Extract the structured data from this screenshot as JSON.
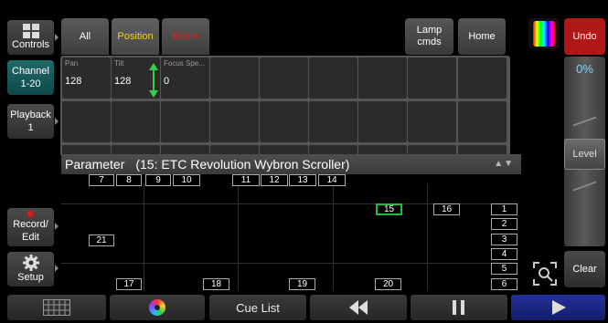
{
  "sidebar": {
    "controls": "Controls",
    "channel": [
      "Channel",
      "1-20"
    ],
    "playback": [
      "Playback",
      "1"
    ],
    "record": [
      "Record/",
      "Edit"
    ],
    "setup": "Setup"
  },
  "tabs": {
    "all": "All",
    "position": "Position",
    "beam": "Beam"
  },
  "toolbar": {
    "lamp": [
      "Lamp",
      "cmds"
    ],
    "home": "Home"
  },
  "params": [
    {
      "label": "Pan",
      "value": "128"
    },
    {
      "label": "Tilt",
      "value": "128"
    },
    {
      "label": "Focus Spe...",
      "value": "0"
    }
  ],
  "parameter_bar": {
    "title": "Parameter",
    "fixture": "(15: ETC Revolution Wybron Scroller)"
  },
  "channels": {
    "row1": [
      "7",
      "8",
      "9",
      "10",
      "11",
      "12",
      "13",
      "14"
    ],
    "ch15": "15",
    "ch16": "16",
    "ch21": "21",
    "row_bottom": [
      "17",
      "18",
      "19",
      "20"
    ],
    "right_col": [
      "1",
      "2",
      "3",
      "4",
      "5",
      "6"
    ]
  },
  "right_panel": {
    "undo": "Undo",
    "percent": "0%",
    "level": "Level",
    "clear": "Clear"
  },
  "bottom_bar": {
    "cue_list": "Cue List"
  },
  "colors": {
    "accent_teal": "#1f6a6a",
    "undo_red": "#b01818",
    "selected_green": "#1fbf3a",
    "play_blue": "#1c2a8a",
    "position_yellow": "#f0d020",
    "beam_red": "#e02020"
  }
}
